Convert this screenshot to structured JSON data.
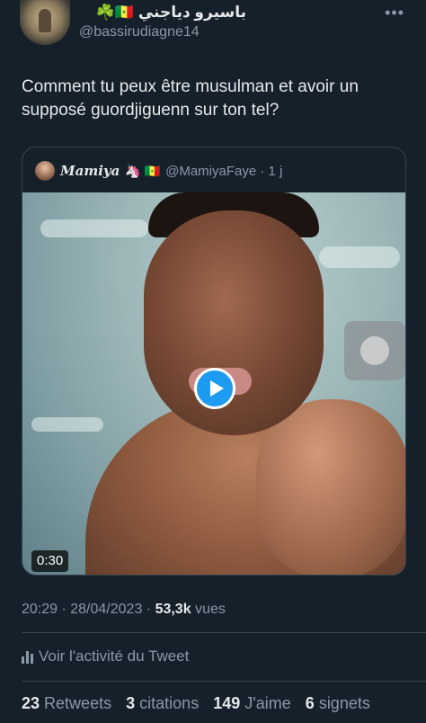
{
  "author": {
    "display_name": "باسيرو دياجني 🇸🇳☘️",
    "handle": "@bassirudiagne14"
  },
  "tweet": {
    "text": "Comment tu peux être musulman et avoir un supposé guordjiguenn sur ton tel?"
  },
  "quote": {
    "name": "Mamiya",
    "emojis": "🦄 🇸🇳",
    "handle_time": "@MamiyaFaye · 1 j",
    "video_duration": "0:30"
  },
  "meta": {
    "time_date": "20:29 · 28/04/2023 · ",
    "views_count": "53,3k",
    "views_label": "vues"
  },
  "activity": {
    "label": "Voir l'activité du Tweet"
  },
  "stats": {
    "retweets_count": "23",
    "retweets_label": "Retweets",
    "quotes_count": "3",
    "quotes_label": "citations",
    "likes_count": "149",
    "likes_label": "J'aime",
    "bookmarks_count": "6",
    "bookmarks_label": "signets"
  },
  "colors": {
    "background": "#15202b",
    "accent": "#1d9bf0",
    "secondary_text": "#8b98a5"
  }
}
